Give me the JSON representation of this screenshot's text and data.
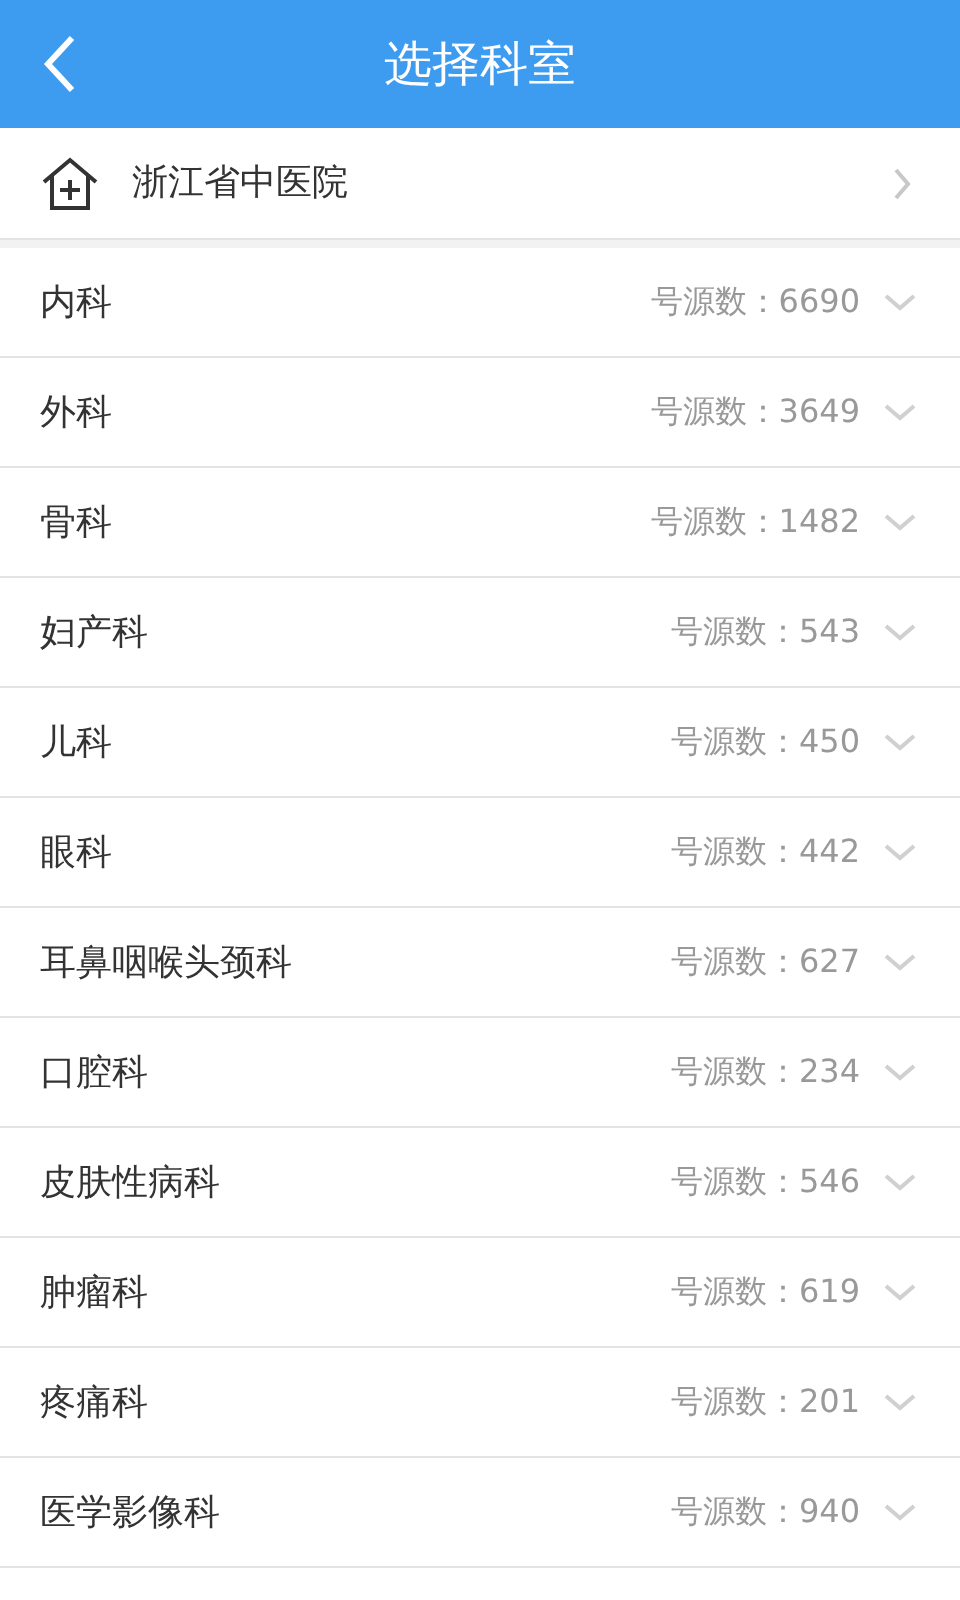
{
  "header": {
    "title": "选择科室"
  },
  "hospital": {
    "name": "浙江省中医院"
  },
  "departments": [
    {
      "name": "内科",
      "count": "号源数：6690"
    },
    {
      "name": "外科",
      "count": "号源数：3649"
    },
    {
      "name": "骨科",
      "count": "号源数：1482"
    },
    {
      "name": "妇产科",
      "count": "号源数：543"
    },
    {
      "name": "儿科",
      "count": "号源数：450"
    },
    {
      "name": "眼科",
      "count": "号源数：442"
    },
    {
      "name": "耳鼻咽喉头颈科",
      "count": "号源数：627"
    },
    {
      "name": "口腔科",
      "count": "号源数：234"
    },
    {
      "name": "皮肤性病科",
      "count": "号源数：546"
    },
    {
      "name": "肿瘤科",
      "count": "号源数：619"
    },
    {
      "name": "疼痛科",
      "count": "号源数：201"
    },
    {
      "name": "医学影像科",
      "count": "号源数：940"
    }
  ]
}
